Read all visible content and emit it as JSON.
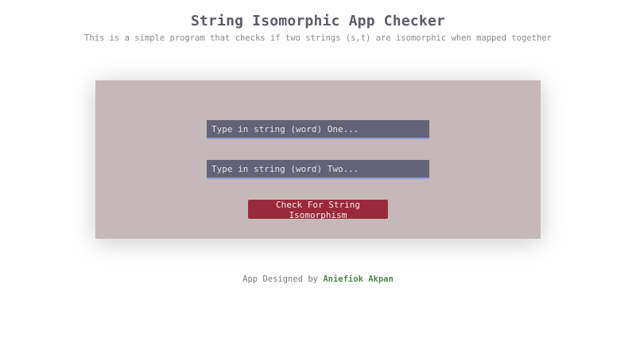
{
  "header": {
    "title": "String Isomorphic App Checker",
    "subtitle": "This is a simple program that checks if two strings (s,t) are isomorphic when mapped together"
  },
  "form": {
    "input_one": {
      "value": "",
      "placeholder": "Type in string (word) One..."
    },
    "input_two": {
      "value": "",
      "placeholder": "Type in string (word) Two..."
    },
    "check_button_label": "Check For String Isomorphism"
  },
  "footer": {
    "prefix": "App Designed by",
    "author": "Aniefiok Akpan"
  },
  "colors": {
    "card_background": "#c4b9b8",
    "input_background": "#646276",
    "input_underline": "#8a9ad4",
    "button_background": "#9a2a3a",
    "author_link": "#4f8a4f",
    "title_text": "#5b5b6b"
  }
}
